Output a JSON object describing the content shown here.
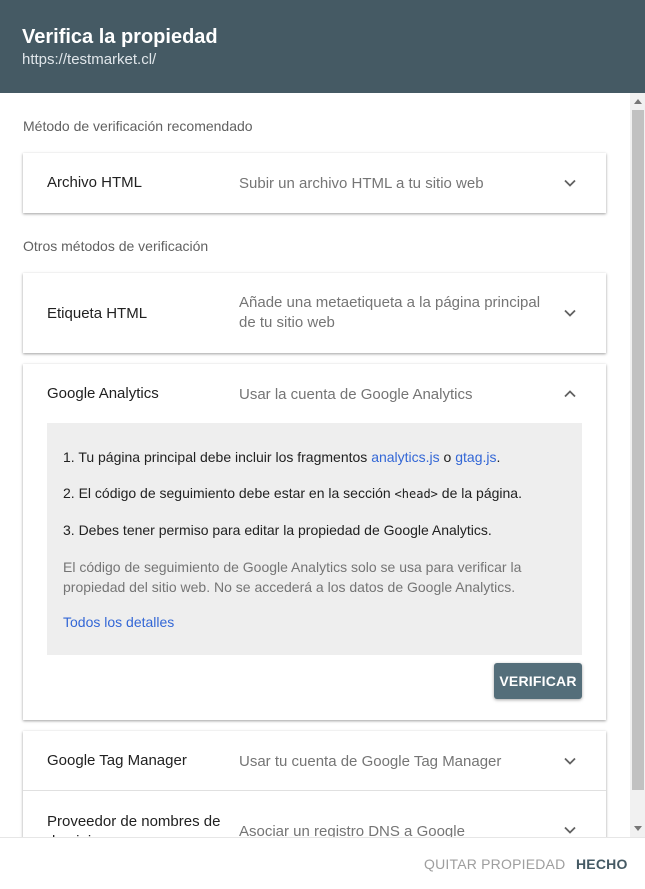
{
  "dialog": {
    "title": "Verifica la propiedad",
    "url": "https://testmarket.cl/"
  },
  "recommended": {
    "label": "Método de verificación recomendado",
    "method": {
      "name": "Archivo HTML",
      "desc": "Subir un archivo HTML a tu sitio web",
      "icon": "chevron-down-icon"
    }
  },
  "others": {
    "label": "Otros métodos de verificación",
    "html_tag": {
      "name": "Etiqueta HTML",
      "desc": "Añade una metaetiqueta a la página principal de tu sitio web",
      "icon": "chevron-down-icon"
    },
    "analytics": {
      "name": "Google Analytics",
      "desc": "Usar la cuenta de Google Analytics",
      "icon": "chevron-up-icon",
      "step1_prefix": "1. Tu página principal debe incluir los fragmentos ",
      "step1_link1": "analytics.js",
      "step1_mid": " o ",
      "step1_link2": "gtag.js",
      "step1_suffix": ".",
      "step2_prefix": "2. El código de seguimiento debe estar en la sección ",
      "step2_code": "<head>",
      "step2_suffix": " de la página.",
      "step3": "3. Debes tener permiso para editar la propiedad de Google Analytics.",
      "note": "El código de seguimiento de Google Analytics solo se usa para verificar la propiedad del sitio web. No se accederá a los datos de Google Analytics.",
      "details_link": "Todos los detalles",
      "verify_label": "VERIFICAR"
    },
    "tag_manager": {
      "name": "Google Tag Manager",
      "desc": "Usar tu cuenta de Google Tag Manager",
      "icon": "chevron-down-icon"
    },
    "dns": {
      "name": "Proveedor de nombres de dominio",
      "desc": "Asociar un registro DNS a Google",
      "icon": "chevron-down-icon"
    }
  },
  "footer": {
    "remove_label": "QUITAR PROPIEDAD",
    "done_label": "HECHO"
  }
}
